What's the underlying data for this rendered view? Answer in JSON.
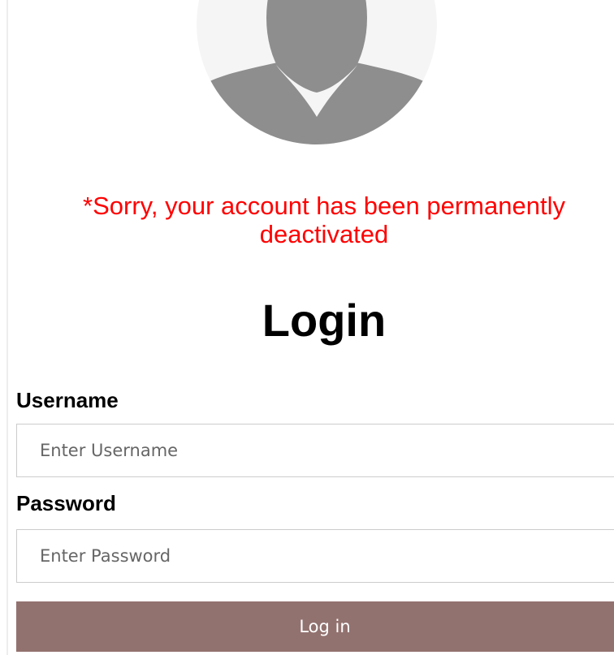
{
  "avatar": {
    "icon": "user-silhouette-icon",
    "background_color": "#f5f5f5",
    "silhouette_color": "#8e8e8e"
  },
  "error": {
    "message": "*Sorry, your account has been permanently\ndeactivated",
    "color": "#ff0000"
  },
  "login": {
    "title": "Login"
  },
  "form": {
    "username_label": "Username",
    "username_placeholder": "Enter Username",
    "username_value": "",
    "password_label": "Password",
    "password_placeholder": "Enter Password",
    "password_value": "",
    "submit_label": "Log in",
    "submit_color": "#92726f"
  }
}
